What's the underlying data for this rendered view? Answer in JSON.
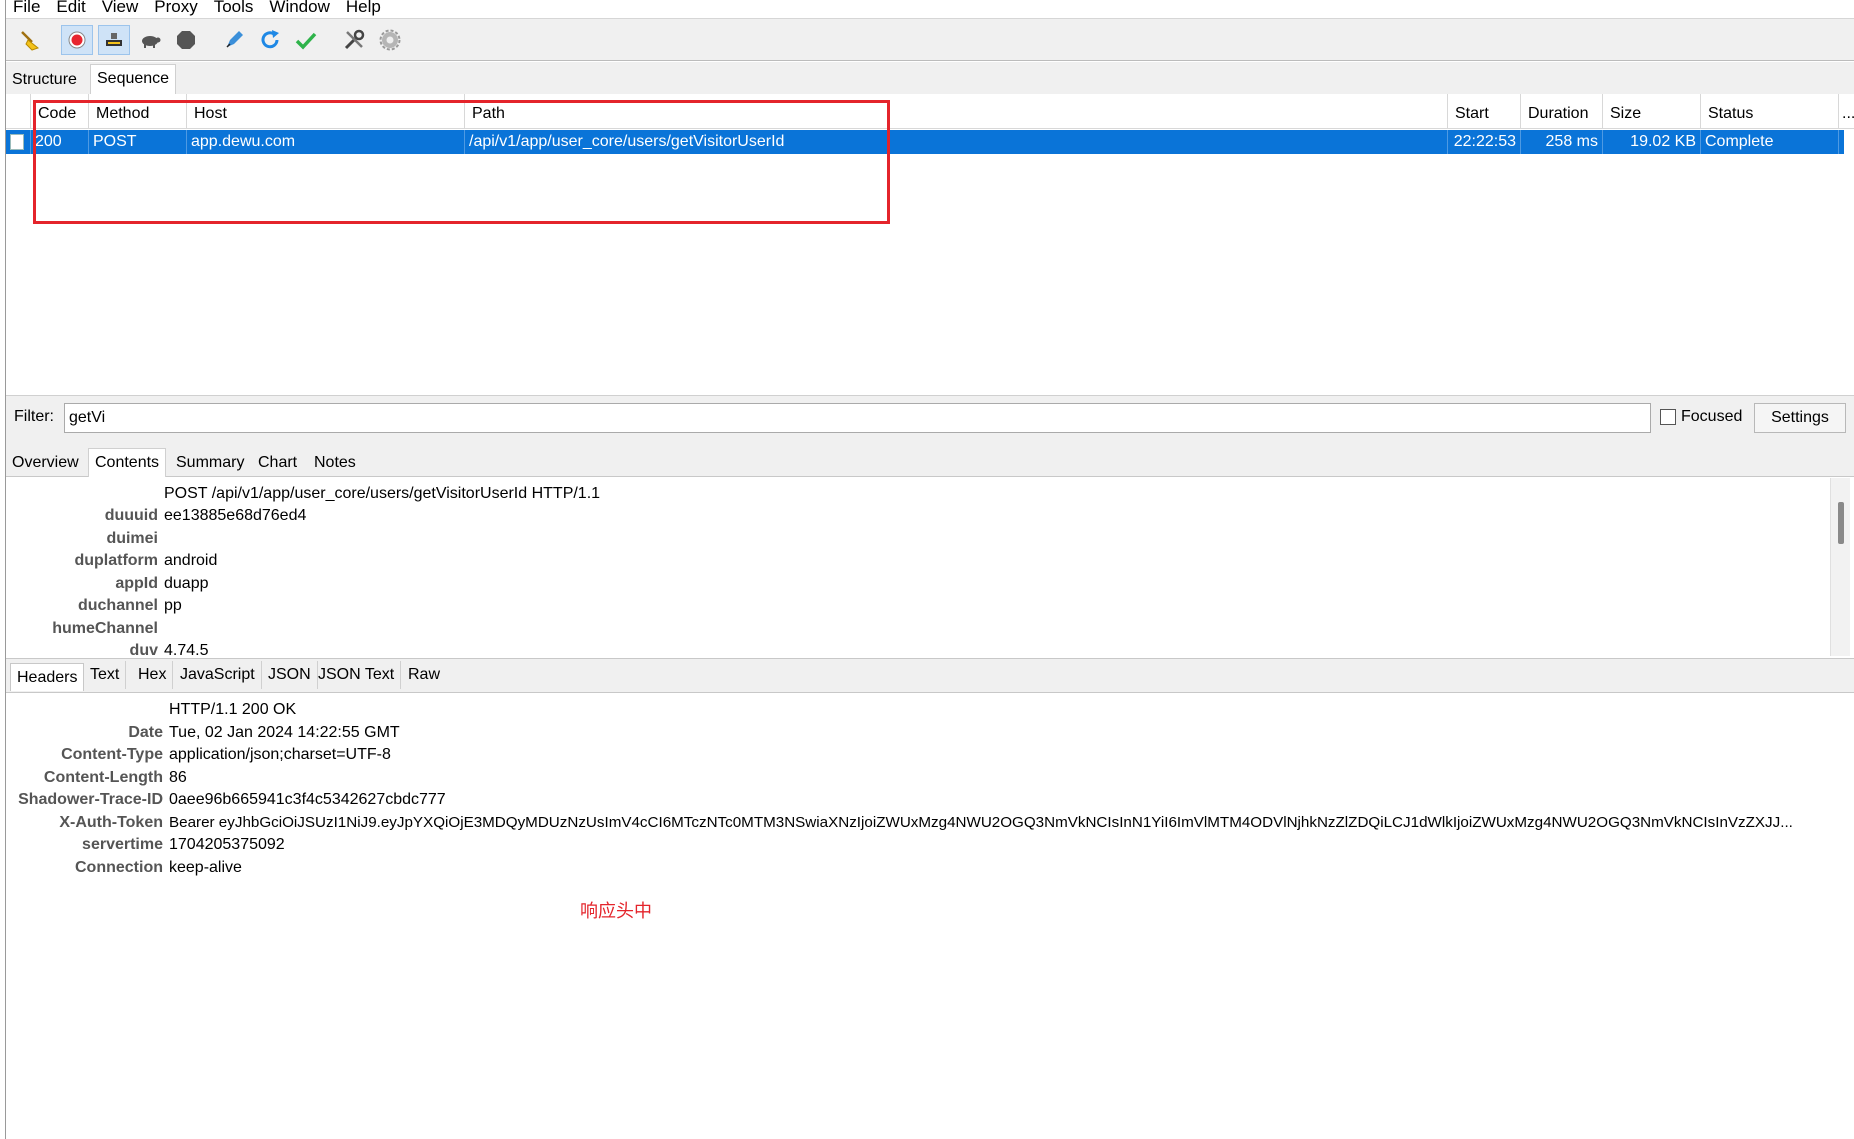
{
  "menu": [
    "File",
    "Edit",
    "View",
    "Proxy",
    "Tools",
    "Window",
    "Help"
  ],
  "toolbar": {
    "icons": [
      "broom-icon",
      "record-icon",
      "throttle-icon",
      "turtle-icon",
      "stop-icon",
      "pen-icon",
      "refresh-icon",
      "check-icon",
      "tools-icon",
      "gear-icon"
    ]
  },
  "view_tabs": [
    "Structure",
    "Sequence"
  ],
  "table": {
    "columns": [
      "Code",
      "Method",
      "Host",
      "Path",
      "Start",
      "Duration",
      "Size",
      "Status",
      "..."
    ],
    "rows": [
      {
        "code": "200",
        "method": "POST",
        "host": "app.dewu.com",
        "path": "/api/v1/app/user_core/users/getVisitorUserId",
        "start": "22:22:53",
        "duration": "258 ms",
        "size": "19.02 KB",
        "status": "Complete"
      }
    ]
  },
  "filter": {
    "label": "Filter:",
    "value": "getVi",
    "focused_label": "Focused",
    "settings_label": "Settings"
  },
  "detail_tabs": [
    "Overview",
    "Contents",
    "Summary",
    "Chart",
    "Notes"
  ],
  "request": {
    "request_line": "POST /api/v1/app/user_core/users/getVisitorUserId HTTP/1.1",
    "headers": [
      {
        "k": "duuuid",
        "v": "ee13885e68d76ed4"
      },
      {
        "k": "duimei",
        "v": ""
      },
      {
        "k": "duplatform",
        "v": "android"
      },
      {
        "k": "appId",
        "v": "duapp"
      },
      {
        "k": "duchannel",
        "v": "pp"
      },
      {
        "k": "humeChannel",
        "v": ""
      },
      {
        "k": "duv",
        "v": "4.74.5"
      }
    ]
  },
  "response_tabs": [
    "Headers",
    "Text",
    "Hex",
    "JavaScript",
    "JSON",
    "JSON Text",
    "Raw"
  ],
  "response": {
    "status_line": "HTTP/1.1 200 OK",
    "headers": [
      {
        "k": "Date",
        "v": "Tue, 02 Jan 2024 14:22:55 GMT"
      },
      {
        "k": "Content-Type",
        "v": "application/json;charset=UTF-8"
      },
      {
        "k": "Content-Length",
        "v": "86"
      },
      {
        "k": "Shadower-Trace-ID",
        "v": "0aee96b665941c3f4c5342627cbdc777"
      },
      {
        "k": "X-Auth-Token",
        "v": "Bearer eyJhbGciOiJSUzI1NiJ9.eyJpYXQiOjE3MDQyMDUzNzUsImV4cCI6MTczNTc0MTM3NSwiaXNzIjoiZWUxMzg4NWU2OGQ3NmVkNCIsInN1YiI6ImVlMTM4ODVlNjhkNzZlZDQiLCJ1dWlkIjoiZWUxMzg4NWU2OGQ3NmVkNCIsInVzZXJJ..."
      },
      {
        "k": "servertime",
        "v": "1704205375092"
      },
      {
        "k": "Connection",
        "v": "keep-alive"
      }
    ]
  },
  "annotation": "响应头中",
  "colors": {
    "selection": "#0a74d8",
    "annotation": "#e4242b"
  }
}
